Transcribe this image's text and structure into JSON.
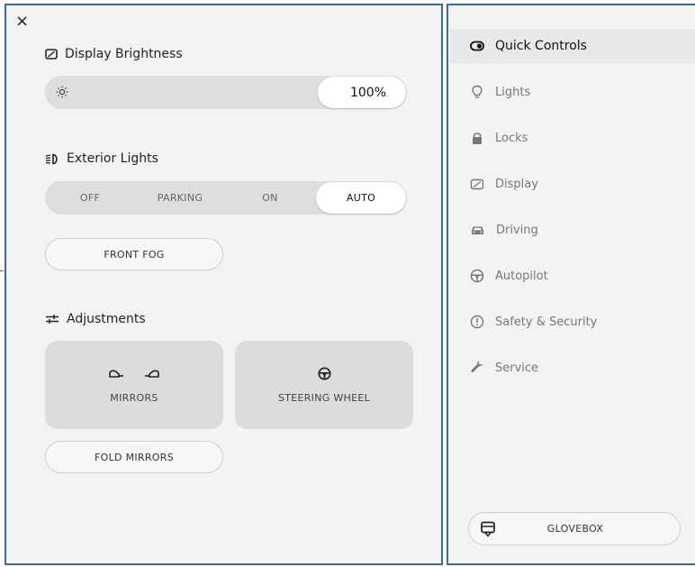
{
  "left_panel": {
    "close_glyph": "×",
    "brightness": {
      "title": "Display Brightness",
      "value_label": "100%",
      "level_percent": 100
    },
    "exterior_lights": {
      "title": "Exterior Lights",
      "options": [
        "OFF",
        "PARKING",
        "ON",
        "AUTO"
      ],
      "selected": "AUTO"
    },
    "front_fog_label": "FRONT FOG",
    "adjustments": {
      "title": "Adjustments",
      "mirrors_label": "MIRRORS",
      "steering_wheel_label": "STEERING WHEEL",
      "fold_mirrors_label": "FOLD MIRRORS"
    }
  },
  "sidebar": {
    "items": [
      {
        "label": "Quick Controls",
        "icon": "toggle-icon",
        "active": true
      },
      {
        "label": "Lights",
        "icon": "bulb-icon",
        "active": false
      },
      {
        "label": "Locks",
        "icon": "lock-icon",
        "active": false
      },
      {
        "label": "Display",
        "icon": "display-icon",
        "active": false
      },
      {
        "label": "Driving",
        "icon": "car-icon",
        "active": false
      },
      {
        "label": "Autopilot",
        "icon": "steering-wheel-icon",
        "active": false
      },
      {
        "label": "Safety & Security",
        "icon": "alert-circle-icon",
        "active": false
      },
      {
        "label": "Service",
        "icon": "wrench-icon",
        "active": false
      }
    ],
    "glovebox_label": "GLOVEBOX"
  },
  "colors": {
    "panel_bg": "#f3f3f3",
    "track_bg": "#dedede",
    "border_accent": "#3b6aa0"
  }
}
